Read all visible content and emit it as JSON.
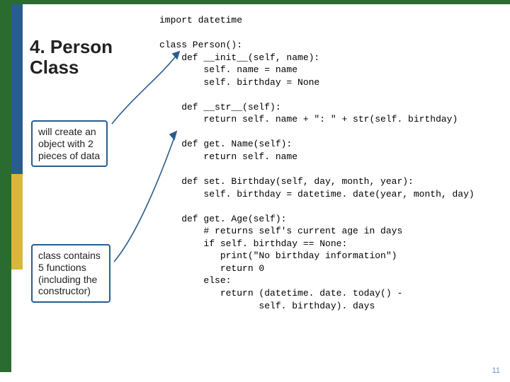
{
  "heading": "4. Person Class",
  "callout1": "will create an object with 2 pieces of data",
  "callout2": "class contains 5 functions (including the constructor)",
  "code": "import datetime\n\nclass Person():\n    def __init__(self, name):\n        self. name = name\n        self. birthday = None\n\n    def __str__(self):\n        return self. name + \": \" + str(self. birthday)\n\n    def get. Name(self):\n        return self. name\n\n    def set. Birthday(self, day, month, year):\n        self. birthday = datetime. date(year, month, day)\n\n    def get. Age(self):\n        # returns self's current age in days\n        if self. birthday == None:\n           print(\"No birthday information\")\n           return 0\n        else:\n           return (datetime. date. today() -\n                  self. birthday). days",
  "page_number": "11"
}
